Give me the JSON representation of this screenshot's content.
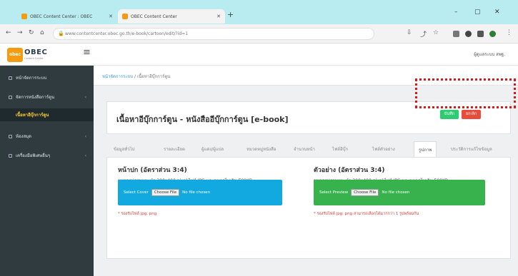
{
  "browser": {
    "tabs": [
      {
        "title": "OBEC Content Center : OBEC",
        "active": false,
        "favicon_color": "#f39c12"
      },
      {
        "title": "OBEC Content Center",
        "active": true,
        "favicon_color": "#f39c12"
      }
    ],
    "new_tab": "+",
    "url": "www.contentcenter.obec.go.th/e-book/cartoon/edit/?id=1",
    "window_controls": {
      "minimize": "–",
      "restore": "▢",
      "close": "✕"
    }
  },
  "header": {
    "logo_badge": "obec",
    "logo_text": "OBEC",
    "logo_sub": "Content Center",
    "user_label": "ผู้ดูแลระบบ สพฐ."
  },
  "sidebar": {
    "items": [
      {
        "label": "หน้าจัดการระบบ",
        "arrow": ""
      },
      {
        "label": "จัดการหนังสือการ์ตูน",
        "arrow": "‹"
      },
      {
        "label": "เนื้อหาอีบุ๊กการ์ตูน",
        "arrow": ""
      },
      {
        "label": "ห้องสมุด",
        "arrow": "‹"
      },
      {
        "label": "เครื่องมือพิเศษอื่นๆ",
        "arrow": "‹"
      }
    ]
  },
  "main": {
    "breadcrumb": {
      "home": "หน้าจัดการระบบ",
      "sep": "/",
      "current": "เนื้อหาอีบุ๊กการ์ตูน"
    },
    "title": "เนื้อหาอีบุ๊กการ์ตูน - หนังสืออีบุ๊กการ์ตูน [e-book]",
    "save_label": "บันทึก",
    "cancel_label": "ยกเลิก",
    "tabs": [
      "ข้อมูลทั่วไป",
      "รายละเอียด",
      "ผู้แต่ง/ผู้แปล",
      "หมวดหมู่หนังสือ",
      "จำนวนหน้า",
      "ไฟล์อีบุ๊ก",
      "ไฟล์ตัวอย่าง",
      "รูปภาพ",
      "ประวัติการแก้ไขข้อมูล"
    ],
    "active_tab_index": 7,
    "cover": {
      "heading": "หน้าปก (อัตราส่วน 3:4)",
      "hint": "ขนาดรูปภาพแนะนำ 300x400 pixel ไฟล์ JPG และขนาดไม่เกิน 500KB",
      "prompt": "Select Cover",
      "button": "Choose File",
      "status": "No file chosen",
      "note": "* รองรับไฟล์ jpg, png"
    },
    "preview": {
      "heading": "ตัวอย่าง (อัตราส่วน 3:4)",
      "hint": "ขนาดรูปภาพแนะนำ 300x400 pixel ไฟล์ JPG และขนาดไม่เกิน 500KB",
      "prompt": "Select Preview",
      "button": "Choose File",
      "status": "No file chosen",
      "note": "* รองรับไฟล์ jpg, png สามารถเลือกได้มากกว่า 1 รูปพร้อมกัน"
    }
  },
  "colors": {
    "sidebar_bg": "#2f3b3f",
    "active_item_text": "#ffcf33",
    "save": "#2ecc71",
    "cancel": "#e74c3c",
    "cover_upload": "#11a9e0",
    "preview_upload": "#37b24d",
    "highlight": "#e01515"
  }
}
